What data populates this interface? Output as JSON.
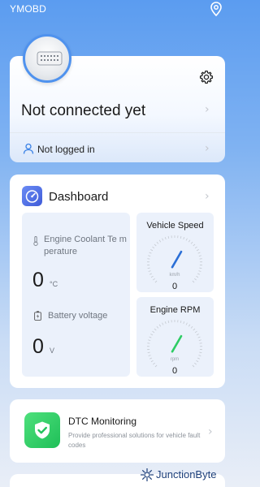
{
  "app": {
    "title": "YMOBD",
    "location_icon": "location-pin-icon"
  },
  "connection": {
    "device_icon": "obd-adapter-icon",
    "settings_icon": "gear-icon",
    "status": "Not connected yet",
    "login_icon": "user-icon",
    "login_status": "Not logged in"
  },
  "dashboard": {
    "icon": "speedometer-icon",
    "title": "Dashboard",
    "coolant": {
      "label": "Engine Coolant Te mperature",
      "value": "0",
      "unit": "°C",
      "icon": "thermometer-icon"
    },
    "battery": {
      "label": "Battery voltage",
      "value": "0",
      "unit": "V",
      "icon": "battery-icon"
    },
    "speed": {
      "title": "Vehicle Speed",
      "unit": "km/h",
      "value": "0",
      "needle_fraction": 0.0
    },
    "rpm": {
      "title": "Engine RPM",
      "unit": "rpm",
      "value": "0",
      "needle_fraction": 0.0
    }
  },
  "dtc": {
    "icon": "shield-check-icon",
    "title": "DTC Monitoring",
    "description": "Provide professional solutions for vehicle fault codes"
  },
  "watermark": {
    "text": "JunctionByte"
  },
  "colors": {
    "accent": "#4f92ee",
    "speed_needle": "#2b6fd6",
    "rpm_needle": "#2ecc64",
    "dtc_green": "#22c35c"
  }
}
